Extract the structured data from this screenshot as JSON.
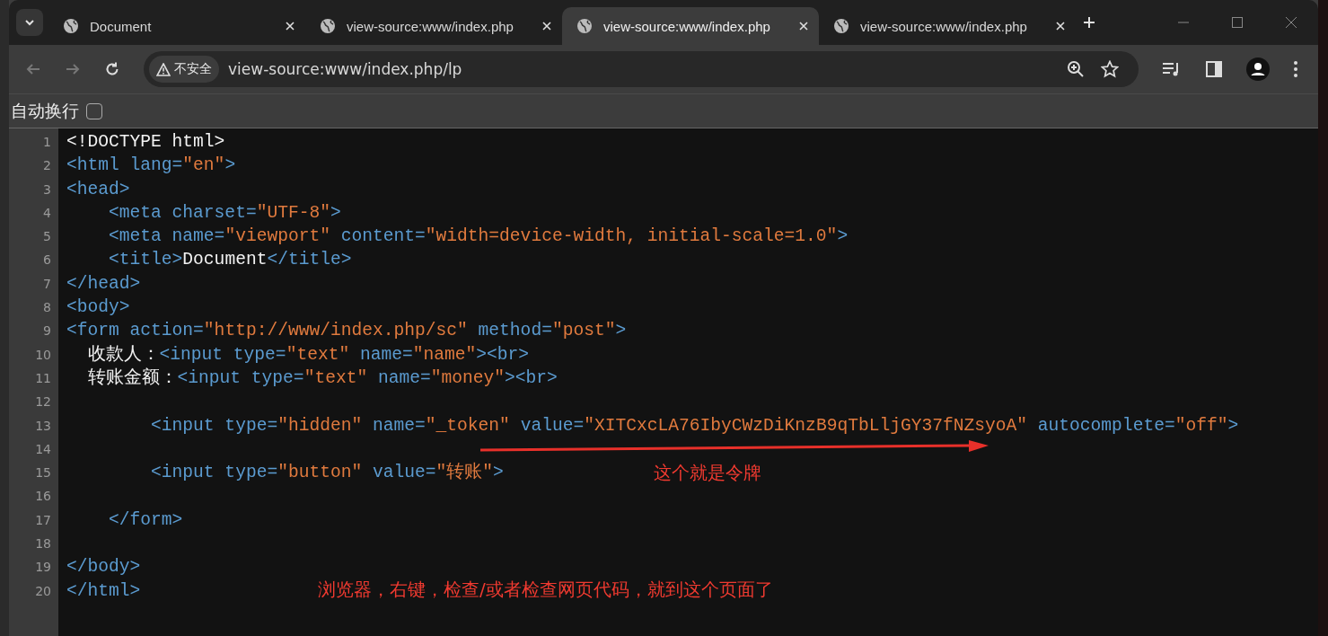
{
  "tabs": [
    {
      "title": "Document",
      "selected": false
    },
    {
      "title": "view-source:www/index.php",
      "selected": false
    },
    {
      "title": "view-source:www/index.php",
      "selected": true
    },
    {
      "title": "view-source:www/index.php",
      "selected": false
    }
  ],
  "address_bar": {
    "security_label": "不安全",
    "url": "view-source:www/index.php/lp"
  },
  "wrap_option": {
    "label": "自动换行",
    "checked": false
  },
  "code_lines": [
    {
      "number": "1",
      "tokens": [
        {
          "kind": "text",
          "text": "<!DOCTYPE html>"
        }
      ]
    },
    {
      "number": "2",
      "tokens": [
        {
          "kind": "tag",
          "text": "<html lang="
        },
        {
          "kind": "value",
          "text": "\"en\""
        },
        {
          "kind": "tag",
          "text": ">"
        }
      ]
    },
    {
      "number": "3",
      "tokens": [
        {
          "kind": "tag",
          "text": "<head>"
        }
      ]
    },
    {
      "number": "4",
      "tokens": [
        {
          "kind": "tag",
          "text": "    <meta charset="
        },
        {
          "kind": "value",
          "text": "\"UTF-8\""
        },
        {
          "kind": "tag",
          "text": ">"
        }
      ]
    },
    {
      "number": "5",
      "tokens": [
        {
          "kind": "tag",
          "text": "    <meta name="
        },
        {
          "kind": "value",
          "text": "\"viewport\""
        },
        {
          "kind": "tag",
          "text": " content="
        },
        {
          "kind": "value",
          "text": "\"width=device-width, initial-scale=1.0\""
        },
        {
          "kind": "tag",
          "text": ">"
        }
      ]
    },
    {
      "number": "6",
      "tokens": [
        {
          "kind": "tag",
          "text": "    <title>"
        },
        {
          "kind": "text",
          "text": "Document"
        },
        {
          "kind": "tag",
          "text": "</title>"
        }
      ]
    },
    {
      "number": "7",
      "tokens": [
        {
          "kind": "tag",
          "text": "</head>"
        }
      ]
    },
    {
      "number": "8",
      "tokens": [
        {
          "kind": "tag",
          "text": "<body>"
        }
      ]
    },
    {
      "number": "9",
      "tokens": [
        {
          "kind": "tag",
          "text": "<form action="
        },
        {
          "kind": "value",
          "text": "\"http://www/index.php/sc\""
        },
        {
          "kind": "tag",
          "text": " method="
        },
        {
          "kind": "value",
          "text": "\"post\""
        },
        {
          "kind": "tag",
          "text": ">"
        }
      ]
    },
    {
      "number": "10",
      "tokens": [
        {
          "kind": "text",
          "text": "  收款人："
        },
        {
          "kind": "tag",
          "text": "<input type="
        },
        {
          "kind": "value",
          "text": "\"text\""
        },
        {
          "kind": "tag",
          "text": " name="
        },
        {
          "kind": "value",
          "text": "\"name\""
        },
        {
          "kind": "tag",
          "text": "><br>"
        }
      ]
    },
    {
      "number": "11",
      "tokens": [
        {
          "kind": "text",
          "text": "  转账金额："
        },
        {
          "kind": "tag",
          "text": "<input type="
        },
        {
          "kind": "value",
          "text": "\"text\""
        },
        {
          "kind": "tag",
          "text": " name="
        },
        {
          "kind": "value",
          "text": "\"money\""
        },
        {
          "kind": "tag",
          "text": "><br>"
        }
      ]
    },
    {
      "number": "12"
    },
    {
      "number": "13",
      "tokens": [
        {
          "kind": "tag",
          "text": "        <input type="
        },
        {
          "kind": "value",
          "text": "\"hidden\""
        },
        {
          "kind": "tag",
          "text": " name="
        },
        {
          "kind": "value",
          "text": "\"_token\""
        },
        {
          "kind": "tag",
          "text": " value="
        },
        {
          "kind": "value",
          "text": "\"XITCxcLA76IbyCWzDiKnzB9qTbLljGY37fNZsyoA\""
        },
        {
          "kind": "tag",
          "text": " autocomplete="
        },
        {
          "kind": "value",
          "text": "\"off\""
        },
        {
          "kind": "tag",
          "text": ">"
        }
      ]
    },
    {
      "number": "14"
    },
    {
      "number": "15",
      "tokens": [
        {
          "kind": "tag",
          "text": "        <input type="
        },
        {
          "kind": "value",
          "text": "\"button\""
        },
        {
          "kind": "tag",
          "text": " value="
        },
        {
          "kind": "value",
          "text": "\"转账\""
        },
        {
          "kind": "tag",
          "text": ">"
        }
      ]
    },
    {
      "number": "16"
    },
    {
      "number": "17",
      "tokens": [
        {
          "kind": "tag",
          "text": "    </form>"
        }
      ]
    },
    {
      "number": "18"
    },
    {
      "number": "19",
      "tokens": [
        {
          "kind": "tag",
          "text": "</body>"
        }
      ]
    },
    {
      "number": "20",
      "tokens": [
        {
          "kind": "tag",
          "text": "</html>"
        }
      ]
    }
  ],
  "annotations": [
    {
      "kind": "arrow",
      "text": "这个就是令牌"
    },
    {
      "kind": "note",
      "text": "浏览器，右键，检查/或者检查网页代码，就到这个页面了"
    }
  ]
}
